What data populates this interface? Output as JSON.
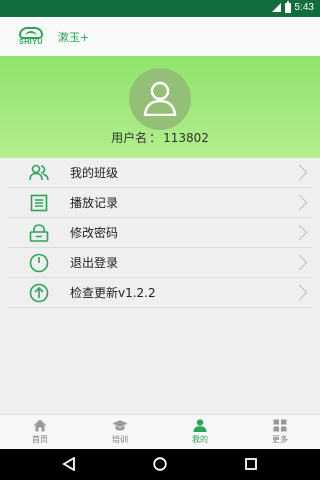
{
  "status_bar": {
    "time": "5:43"
  },
  "header": {
    "logo_text": "SHIYU",
    "title": "漱玉+"
  },
  "profile": {
    "username_label": "用户名",
    "separator": "：",
    "username": "113802"
  },
  "menu": {
    "items": [
      {
        "label": "我的班级",
        "icon": "users-icon"
      },
      {
        "label": "播放记录",
        "icon": "list-icon"
      },
      {
        "label": "修改密码",
        "icon": "lock-icon"
      },
      {
        "label": "退出登录",
        "icon": "power-icon"
      },
      {
        "label": "检查更新v1.2.2",
        "icon": "upload-icon"
      }
    ]
  },
  "tabs": [
    {
      "label": "首页",
      "icon": "home-icon",
      "active": false
    },
    {
      "label": "培训",
      "icon": "graduation-cap-icon",
      "active": false
    },
    {
      "label": "我的",
      "icon": "person-icon",
      "active": true
    },
    {
      "label": "更多",
      "icon": "grid-icon",
      "active": false
    }
  ],
  "colors": {
    "status_bar": "#116e3c",
    "accent": "#2aa655",
    "profile_bg": "#a0e87d",
    "avatar_bg": "#93bf76"
  }
}
